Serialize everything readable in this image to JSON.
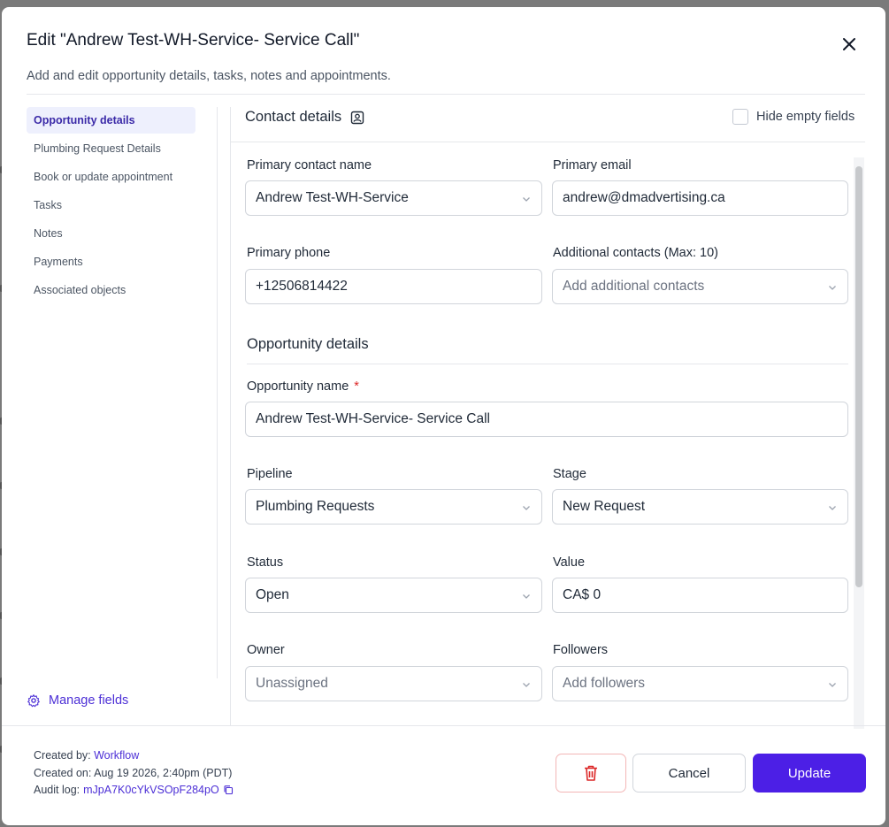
{
  "modal": {
    "title": "Edit \"Andrew Test-WH-Service- Service Call\"",
    "subtitle": "Add and edit opportunity details, tasks, notes and appointments."
  },
  "sidebar": {
    "items": [
      {
        "label": "Opportunity details",
        "active": true
      },
      {
        "label": "Plumbing Request Details"
      },
      {
        "label": "Book or update appointment"
      },
      {
        "label": "Tasks"
      },
      {
        "label": "Notes"
      },
      {
        "label": "Payments"
      },
      {
        "label": "Associated objects"
      }
    ],
    "manage_fields": "Manage fields"
  },
  "contact": {
    "section_title": "Contact details",
    "hide_empty_label": "Hide empty fields",
    "hide_empty_checked": false,
    "primary_contact_name_label": "Primary contact name",
    "primary_contact_name_value": "Andrew Test-WH-Service",
    "primary_email_label": "Primary email",
    "primary_email_value": "andrew@dmadvertising.ca",
    "primary_phone_label": "Primary phone",
    "primary_phone_value": "+12506814422",
    "additional_contacts_label": "Additional contacts (Max: 10)",
    "additional_contacts_placeholder": "Add additional contacts"
  },
  "opportunity": {
    "section_title": "Opportunity details",
    "name_label": "Opportunity name",
    "required_mark": "*",
    "name_value": "Andrew Test-WH-Service- Service Call",
    "pipeline_label": "Pipeline",
    "pipeline_value": "Plumbing Requests",
    "stage_label": "Stage",
    "stage_value": "New Request",
    "status_label": "Status",
    "status_value": "Open",
    "value_label": "Value",
    "value_value": "CA$ 0",
    "owner_label": "Owner",
    "owner_placeholder": "Unassigned",
    "followers_label": "Followers",
    "followers_placeholder": "Add followers"
  },
  "footer": {
    "created_by_label": "Created by:",
    "created_by_value": "Workflow",
    "created_on_label": "Created on:",
    "created_on_value": "Aug 19 2026, 2:40pm (PDT)",
    "audit_log_label": "Audit log:",
    "audit_log_value": "mJpA7K0cYkVSOpF284pO",
    "cancel_label": "Cancel",
    "update_label": "Update"
  },
  "colors": {
    "accent": "#4c1fe6",
    "link": "#4c2fd6",
    "danger": "#dc2626",
    "active_nav_bg": "#eef0fd"
  },
  "icons": [
    "close-icon",
    "contact-card-icon",
    "gear-icon",
    "chevron-down-icon",
    "trash-icon",
    "copy-icon"
  ]
}
